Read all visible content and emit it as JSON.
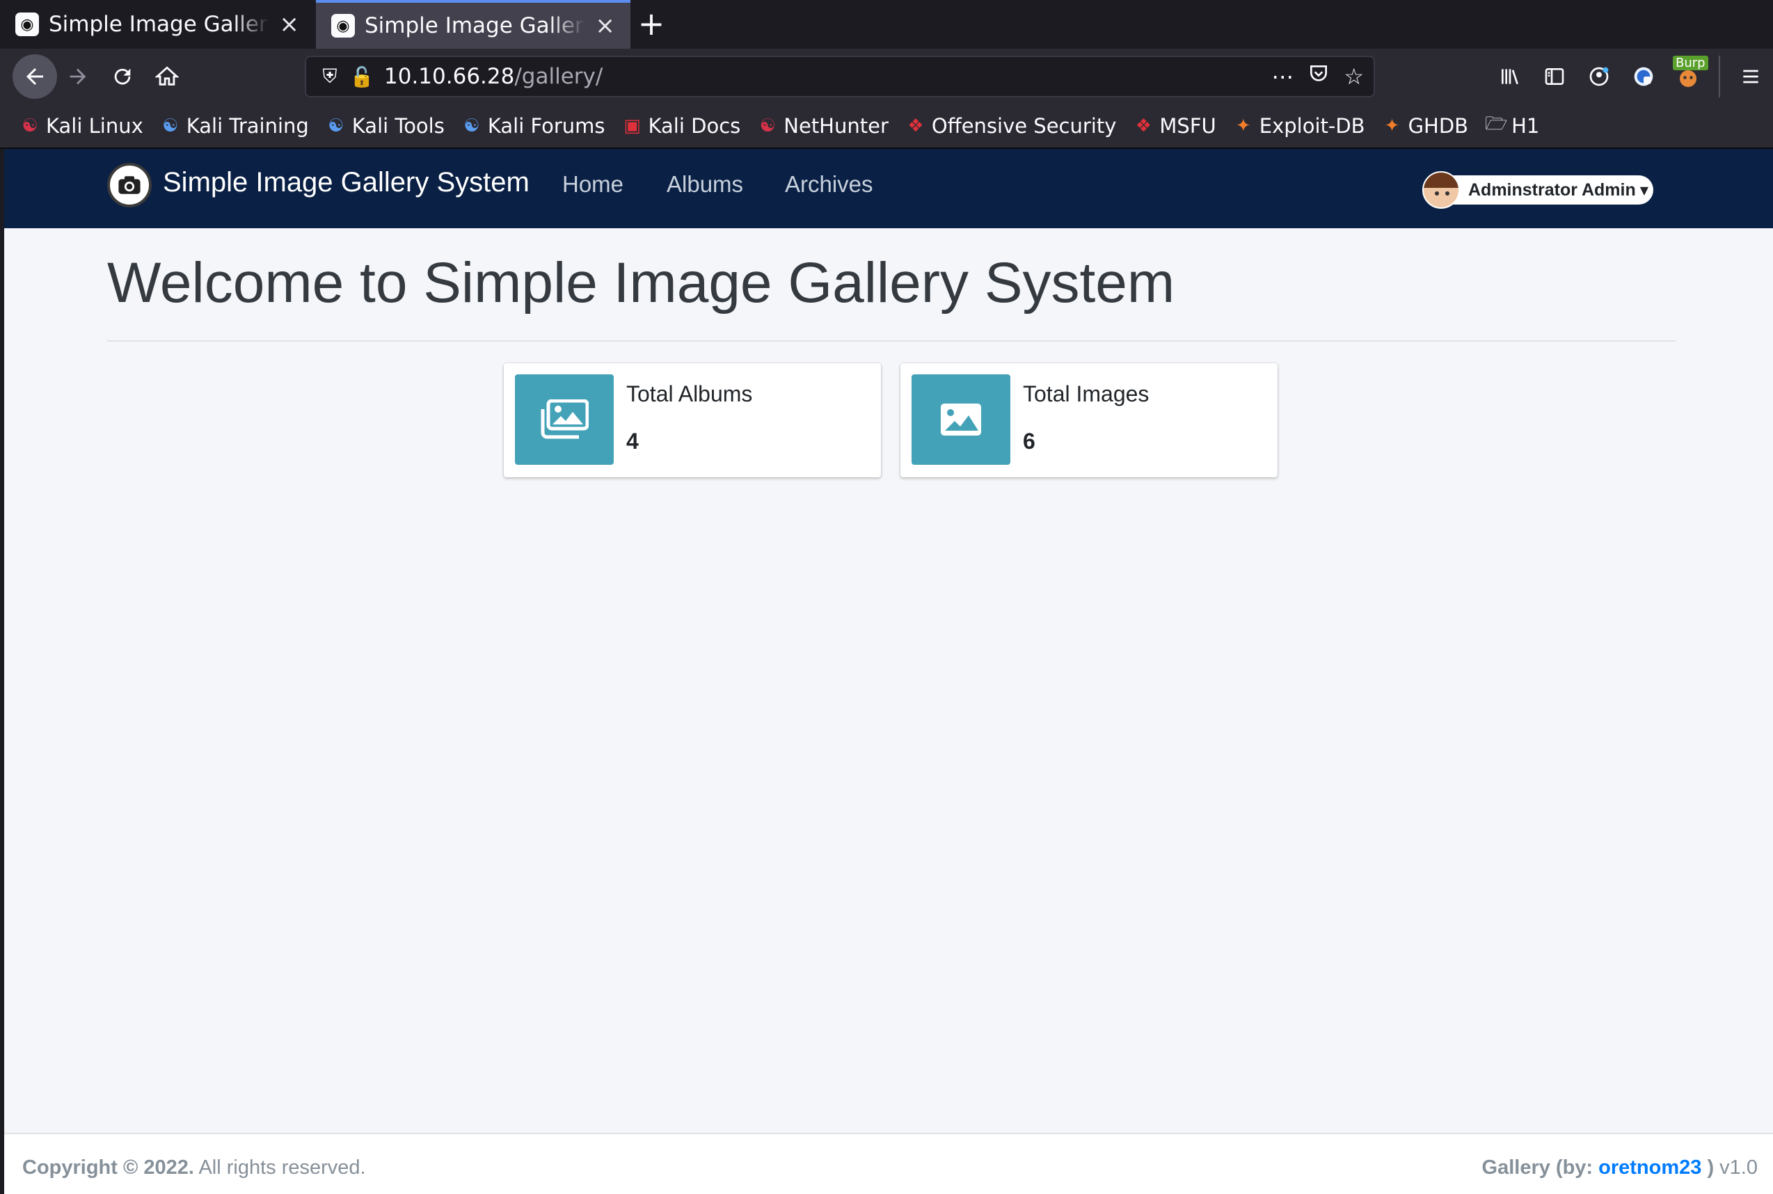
{
  "browser": {
    "tabs": [
      {
        "title": "Simple Image Gallery System",
        "active": false
      },
      {
        "title": "Simple Image Gallery System",
        "active": true
      }
    ],
    "new_tab_label": "+",
    "url_host": "10.10.66.28",
    "url_path": "/gallery/",
    "burp_badge": "Burp",
    "bookmarks": [
      {
        "label": "Kali Linux",
        "icon": "kali-dragon-icon"
      },
      {
        "label": "Kali Training",
        "icon": "kali-blue-icon"
      },
      {
        "label": "Kali Tools",
        "icon": "kali-blue-icon"
      },
      {
        "label": "Kali Forums",
        "icon": "kali-blue-icon"
      },
      {
        "label": "Kali Docs",
        "icon": "kali-docs-icon"
      },
      {
        "label": "NetHunter",
        "icon": "kali-dragon-icon"
      },
      {
        "label": "Offensive Security",
        "icon": "offsec-icon"
      },
      {
        "label": "MSFU",
        "icon": "offsec-icon"
      },
      {
        "label": "Exploit-DB",
        "icon": "exploitdb-icon"
      },
      {
        "label": "GHDB",
        "icon": "exploitdb-icon"
      },
      {
        "label": "H1",
        "icon": "folder-icon"
      }
    ]
  },
  "app": {
    "brand": "Simple Image Gallery System",
    "nav": [
      "Home",
      "Albums",
      "Archives"
    ],
    "user": "Adminstrator Admin",
    "welcome": "Welcome to Simple Image Gallery System",
    "stats": [
      {
        "label": "Total Albums",
        "value": "4",
        "icon": "images-icon"
      },
      {
        "label": "Total Images",
        "value": "6",
        "icon": "image-icon"
      }
    ],
    "accent_color": "#44a2b8",
    "nav_color": "#0a2044",
    "footer": {
      "copyright_bold": "Copyright © 2022.",
      "copyright_rest": " All rights reserved.",
      "right_prefix": "Gallery (by: ",
      "author": "oretnom23",
      "right_suffix": " )",
      "version": " v1.0"
    }
  }
}
